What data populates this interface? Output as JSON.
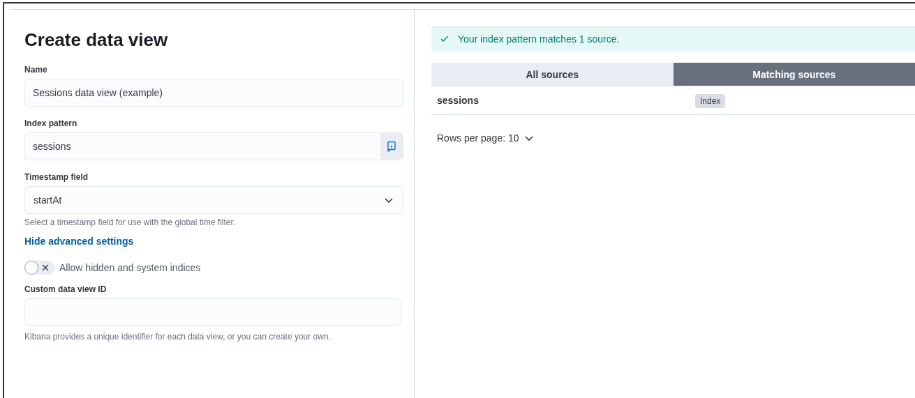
{
  "form": {
    "title": "Create data view",
    "name": {
      "label": "Name",
      "value": "Sessions data view (example)"
    },
    "index_pattern": {
      "label": "Index pattern",
      "value": "sessions"
    },
    "timestamp": {
      "label": "Timestamp field",
      "value": "startAt",
      "help": "Select a timestamp field for use with the global time filter."
    },
    "advanced_link": "Hide advanced settings",
    "hidden_toggle": {
      "label": "Allow hidden and system indices",
      "on": false
    },
    "custom_id": {
      "label": "Custom data view ID",
      "help": "Kibana provides a unique identifier for each data view, or you can create your own."
    }
  },
  "sources": {
    "callout": "Your index pattern matches 1 source.",
    "tabs": [
      {
        "label": "All sources",
        "selected": false
      },
      {
        "label": "Matching sources",
        "selected": true
      }
    ],
    "rows": [
      {
        "name": "sessions",
        "type": "Index"
      }
    ],
    "rows_per_page": "Rows per page: 10"
  }
}
